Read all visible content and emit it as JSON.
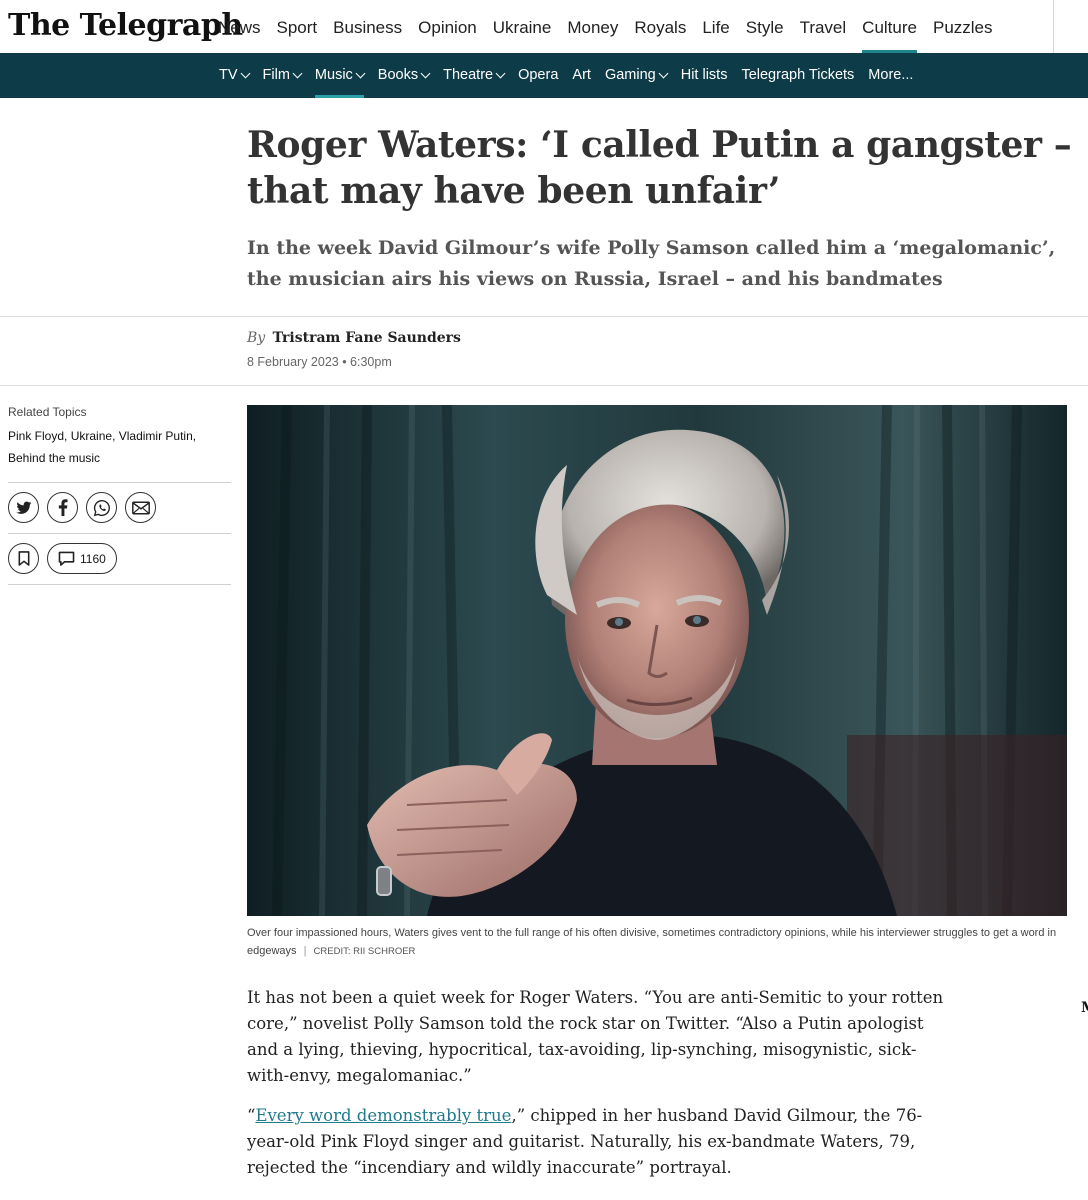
{
  "masthead": {
    "logo": "The Telegraph",
    "nav": [
      "News",
      "Sport",
      "Business",
      "Opinion",
      "Ukraine",
      "Money",
      "Royals",
      "Life",
      "Style",
      "Travel",
      "Culture",
      "Puzzles"
    ],
    "active": "Culture",
    "accent_color": "#21838c"
  },
  "subnav": {
    "background": "#0d3b47",
    "items": [
      {
        "label": "TV",
        "dropdown": true
      },
      {
        "label": "Film",
        "dropdown": true
      },
      {
        "label": "Music",
        "dropdown": true,
        "active": true
      },
      {
        "label": "Books",
        "dropdown": true
      },
      {
        "label": "Theatre",
        "dropdown": true
      },
      {
        "label": "Opera",
        "dropdown": false
      },
      {
        "label": "Art",
        "dropdown": false
      },
      {
        "label": "Gaming",
        "dropdown": true
      },
      {
        "label": "Hit lists",
        "dropdown": false
      },
      {
        "label": "Telegraph Tickets",
        "dropdown": false
      },
      {
        "label": "More...",
        "dropdown": false
      }
    ]
  },
  "article": {
    "headline": "Roger Waters: ‘I called Putin a gangster – that may have been unfair’",
    "standfirst": "In the week David Gilmour’s wife Polly Samson called him a ‘megalomanic’, the musician airs his views on Russia, Israel – and his bandmates",
    "byline_prefix": "By",
    "author": "Tristram Fane Saunders",
    "date": "8 February 2023 • 6:30pm",
    "caption": "Over four impassioned hours, Waters gives vent to the full range of his often divisive, sometimes contradictory opinions, while his interviewer struggles to get a word in edgeways",
    "credit": "CREDIT: Rii Schroer",
    "paragraph1": "It has not been a quiet week for Roger Waters. “You are anti-Semitic to your rotten core,” novelist Polly Samson told the rock star on Twitter. “Also a Putin apologist and a lying, thieving, hypocritical, tax-avoiding, lip-synching, misogynistic, sick-with-envy, megalomaniac.”",
    "paragraph2_open": "“",
    "paragraph2_link": "Every word demonstrably true",
    "paragraph2_rest": ",” chipped in her husband David Gilmour, the 76-year-old Pink Floyd singer and guitarist. Naturally, his ex-bandmate Waters, 79, rejected the “incendiary and wildly inaccurate” portrayal.",
    "edge_letter": "M"
  },
  "rail": {
    "label": "Related Topics",
    "topics": [
      "Pink Floyd",
      "Ukraine",
      "Vladimir Putin",
      "Behind the music"
    ],
    "share_icons": [
      "twitter-icon",
      "facebook-icon",
      "whatsapp-icon",
      "email-icon"
    ],
    "comment_count": "1160"
  }
}
